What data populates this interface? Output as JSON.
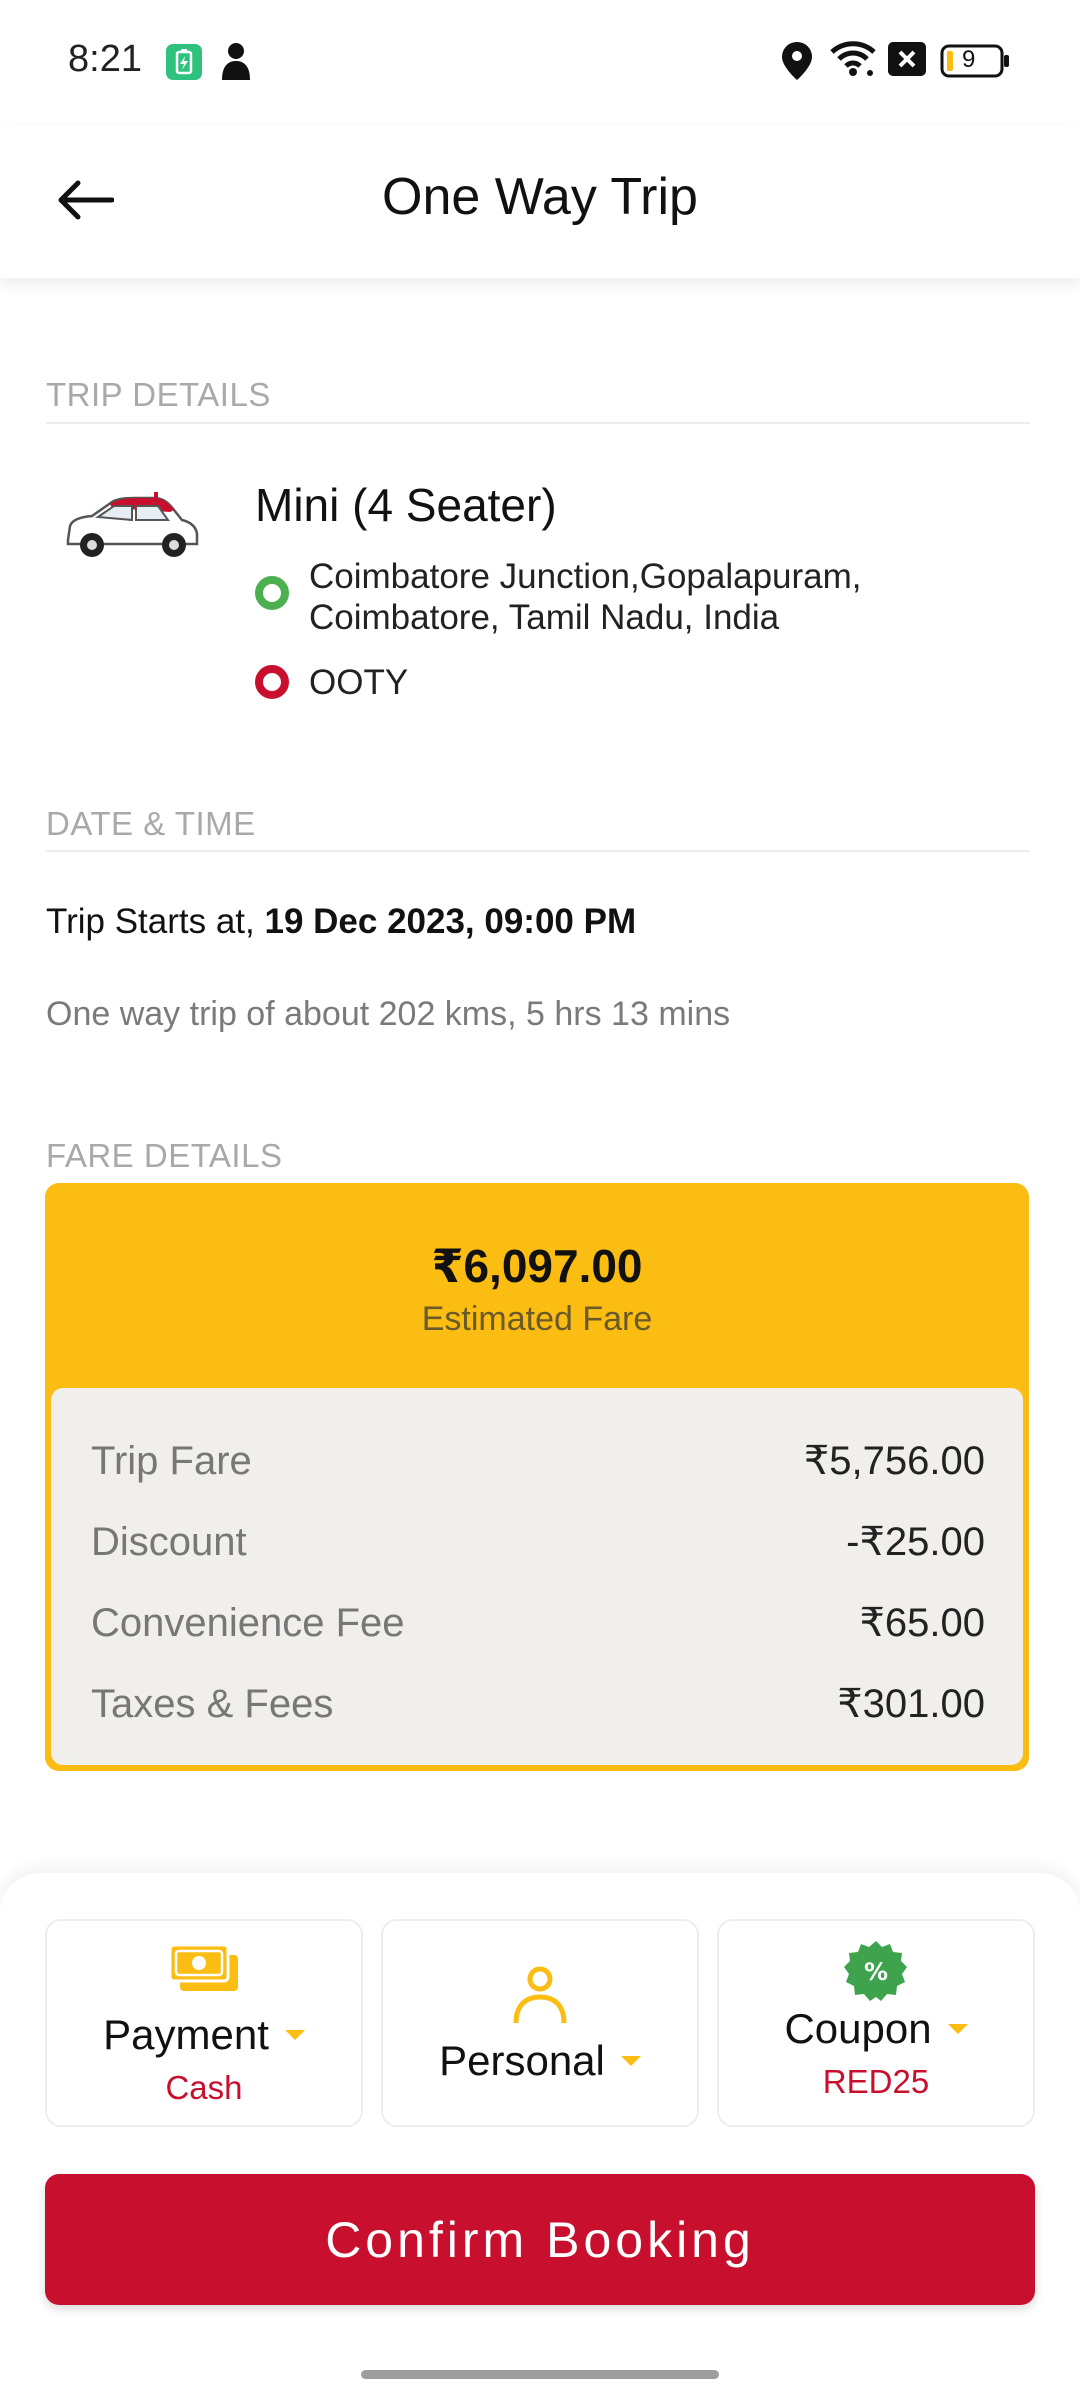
{
  "status_bar": {
    "time": "8:21",
    "battery_level": "9",
    "icons": [
      "battery-saver-icon",
      "person-icon",
      "location-icon",
      "wifi-icon",
      "no-signal-icon",
      "battery-icon"
    ]
  },
  "header": {
    "title": "One Way Trip",
    "back_icon": "arrow-left-icon"
  },
  "trip_details": {
    "section_label": "TRIP DETAILS",
    "vehicle_icon": "car-icon",
    "vehicle_name": "Mini (4 Seater)",
    "pickup": {
      "line1": "Coimbatore Junction,Gopalapuram,",
      "line2": "Coimbatore, Tamil Nadu, India",
      "dot_color": "#4caf50"
    },
    "drop": {
      "text": "OOTY",
      "dot_color": "#c8102e"
    }
  },
  "date_time": {
    "section_label": "DATE & TIME",
    "starts_prefix": "Trip Starts at, ",
    "starts_value": "19 Dec 2023, 09:00 PM",
    "summary": "One way trip of about 202 kms, 5 hrs 13 mins"
  },
  "fare_details": {
    "section_label": "FARE DETAILS",
    "total": "₹6,097.00",
    "total_label": "Estimated Fare",
    "rows": [
      {
        "label": "Trip Fare",
        "value": "₹5,756.00"
      },
      {
        "label": "Discount",
        "value": "-₹25.00"
      },
      {
        "label": "Convenience Fee",
        "value": "₹65.00"
      },
      {
        "label": "Taxes & Fees",
        "value": "₹301.00"
      }
    ]
  },
  "options": {
    "payment": {
      "label": "Payment",
      "value": "Cash",
      "icon": "cash-icon"
    },
    "profile": {
      "label": "Personal",
      "icon": "person-outline-icon"
    },
    "coupon": {
      "label": "Coupon",
      "value": "RED25",
      "icon": "discount-badge-icon"
    }
  },
  "confirm_button": "Confirm Booking",
  "colors": {
    "accent_yellow": "#fcbd12",
    "brand_red": "#c8102e",
    "pickup_green": "#4caf50"
  }
}
